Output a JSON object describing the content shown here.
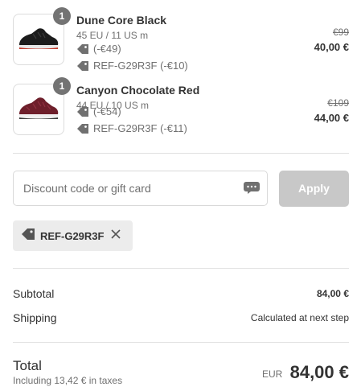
{
  "items": [
    {
      "quantity": "1",
      "name": "Dune Core Black",
      "variant": "45 EU / 11 US m",
      "discount_amount": "(-€49)",
      "discount_code": "REF-G29R3F (-€10)",
      "original_price": "€99",
      "price": "40,00 €",
      "image_icon": "black-sneaker-icon"
    },
    {
      "quantity": "1",
      "name": "Canyon Chocolate Red",
      "variant": "44 EU / 10 US m",
      "discount_amount": "(-€54)",
      "discount_code": "REF-G29R3F (-€11)",
      "original_price": "€109",
      "price": "44,00 €",
      "image_icon": "red-sneaker-icon"
    }
  ],
  "discount_form": {
    "placeholder": "Discount code or gift card",
    "value": "",
    "apply_label": "Apply"
  },
  "applied_code": {
    "label": "REF-G29R3F"
  },
  "summary": {
    "subtotal_label": "Subtotal",
    "subtotal_value": "84,00 €",
    "shipping_label": "Shipping",
    "shipping_value": "Calculated at next step"
  },
  "total": {
    "label": "Total",
    "taxes_note": "Including 13,42 € in taxes",
    "currency": "EUR",
    "value": "84,00 €"
  },
  "colors": {
    "apply_button_disabled": "#c8c8c8",
    "badge": "#737373",
    "chip_bg": "#ececec"
  }
}
